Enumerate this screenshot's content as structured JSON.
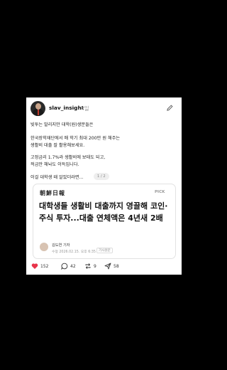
{
  "post": {
    "username": "slav_insight",
    "time": "4일",
    "lines": [
      "빚투는 말리지만 대학(원)생분들은",
      "한국장학재단에서 매 학기 최대 200만 원 해주는",
      "생활비 대출 잘 활용해보세요.",
      "고정금리 1.7%라 생활비에 보태도 되고,",
      "적금만 해놔도 이득입니다."
    ],
    "last_line": "이걸 대학생 때 알았더라면...",
    "pager": "1 / 2"
  },
  "article": {
    "publisher": "朝鮮日報",
    "pick": "PICK",
    "headline": "대학생들 생활비 대출까지 영끌해 코인·주식 투자...대출 연체액은 4년새 2배",
    "reporter": "김도연 기자",
    "updated": "수정 2026.02.15. 오후 6:35",
    "original_label": "기사원문"
  },
  "actions": {
    "likes": "152",
    "comments": "42",
    "reposts": "9",
    "shares": "58"
  },
  "colors": {
    "like": "#e8334a",
    "background": "#000000",
    "card": "#ffffff"
  }
}
